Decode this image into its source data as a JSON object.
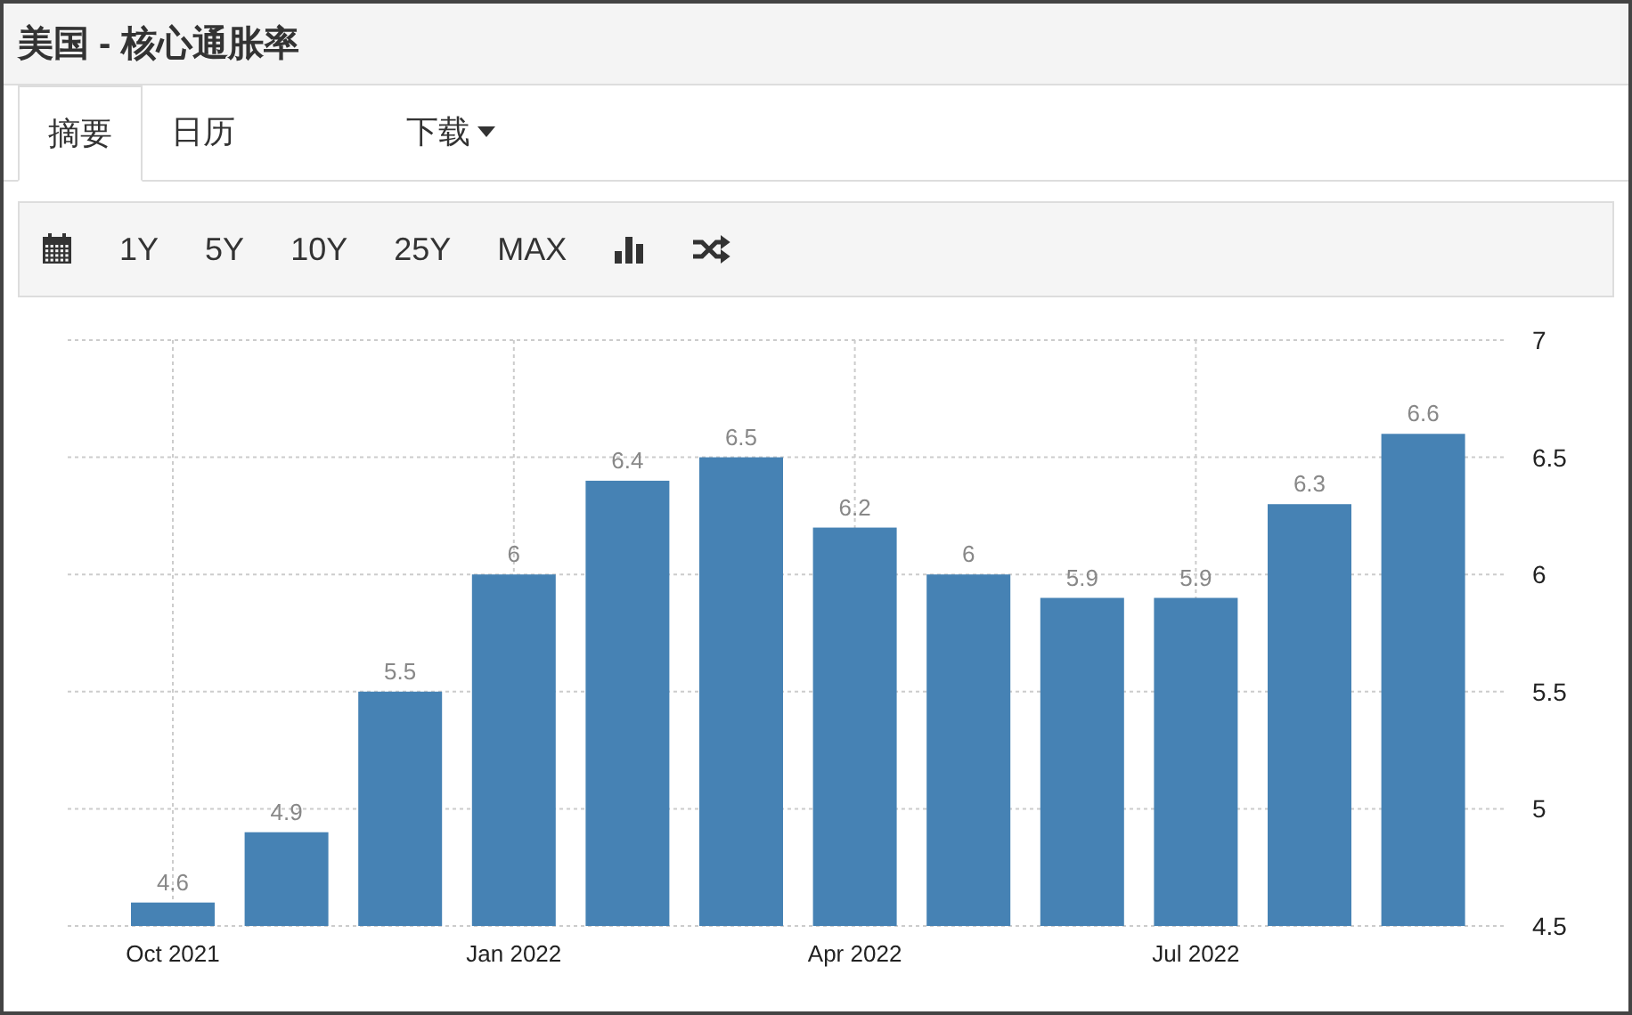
{
  "window": {
    "title": "美国 - 核心通胀率"
  },
  "tabs": [
    {
      "label": "摘要",
      "selected": true,
      "kind": "tab"
    },
    {
      "label": "日历",
      "selected": false,
      "kind": "tab"
    },
    {
      "label": "下载",
      "selected": false,
      "kind": "dropdown"
    }
  ],
  "toolbar": {
    "ranges": [
      "1Y",
      "5Y",
      "10Y",
      "25Y",
      "MAX"
    ]
  },
  "chart": {
    "chart_data": {
      "type": "bar",
      "categories": [
        "Oct 2021",
        null,
        null,
        "Jan 2022",
        null,
        null,
        "Apr 2022",
        null,
        null,
        "Jul 2022",
        null,
        null
      ],
      "series": [
        {
          "color": "#4682b4",
          "values": [
            4.6,
            4.9,
            5.5,
            6,
            6.4,
            6.5,
            6.2,
            6,
            5.9,
            5.9,
            6.3,
            6.6
          ]
        }
      ],
      "ylim": [
        4.5,
        7
      ],
      "yticks": [
        4.5,
        5,
        5.5,
        6,
        6.5,
        7
      ],
      "grid": true,
      "data_labels": true
    }
  }
}
